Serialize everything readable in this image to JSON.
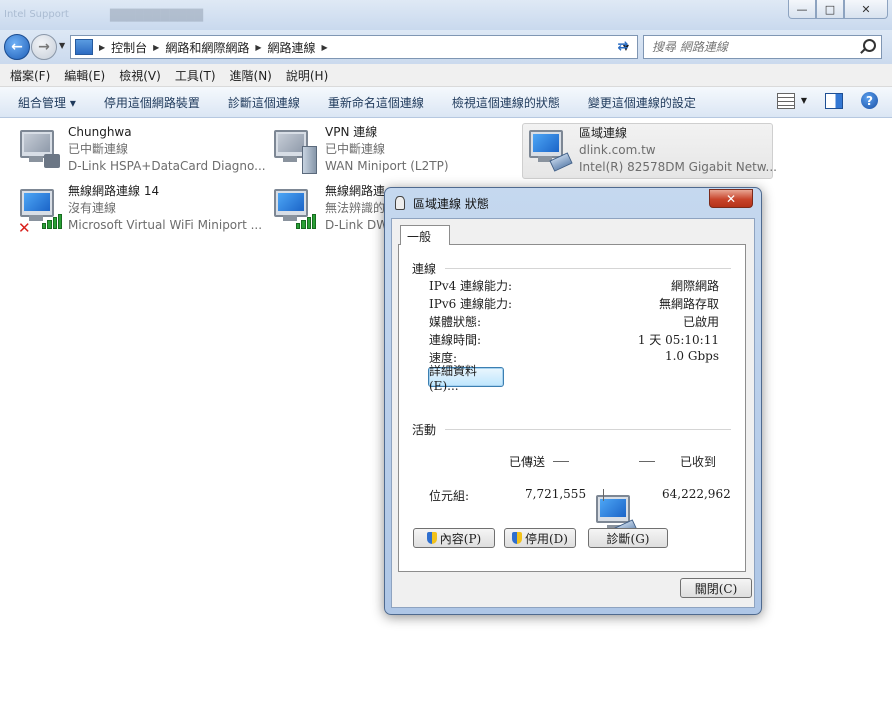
{
  "window": {
    "ghost_title": "███████████",
    "ghost_left": "Intel Support",
    "controls": [
      "—",
      "□",
      "✕"
    ]
  },
  "address": {
    "crumbs": [
      "控制台",
      "網路和網際網路",
      "網路連線"
    ],
    "search_placeholder": "搜尋 網路連線"
  },
  "menu": [
    "檔案(F)",
    "編輯(E)",
    "檢視(V)",
    "工具(T)",
    "進階(N)",
    "說明(H)"
  ],
  "commands": [
    "組合管理 ▾",
    "停用這個網路裝置",
    "診斷這個連線",
    "重新命名這個連線",
    "檢視這個連線的狀態",
    "變更這個連線的設定"
  ],
  "connections": [
    {
      "name": "Chunghwa",
      "status": "已中斷連線",
      "device": "D-Link HSPA+DataCard Diagno..."
    },
    {
      "name": "VPN 連線",
      "status": "已中斷連線",
      "device": "WAN Miniport (L2TP)"
    },
    {
      "name": "區域連線",
      "status": "dlink.com.tw",
      "device": "Intel(R) 82578DM Gigabit Netw..."
    },
    {
      "name": "無線網路連線 14",
      "status": "沒有連線",
      "device": "Microsoft Virtual WiFi Miniport ..."
    },
    {
      "name": "無線網路連",
      "status": "無法辨識的",
      "device": "D-Link DW"
    }
  ],
  "dialog": {
    "title": "區域連線 狀態",
    "close": "✕",
    "tab": "一般",
    "connection_section": "連線",
    "rows": [
      {
        "label": "IPv4 連線能力:",
        "value": "網際網路"
      },
      {
        "label": "IPv6 連線能力:",
        "value": "無網路存取"
      },
      {
        "label": "媒體狀態:",
        "value": "已啟用"
      },
      {
        "label": "連線時間:",
        "value": "1 天 05:10:11"
      },
      {
        "label": "速度:",
        "value": "1.0 Gbps"
      }
    ],
    "details_button": "詳細資料(E)...",
    "activity_section": "活動",
    "sent_label": "已傳送",
    "received_label": "已收到",
    "bytes_label": "位元組:",
    "bytes_sent": "7,721,555",
    "bytes_received": "64,222,962",
    "properties_button": "內容(P)",
    "disable_button": "停用(D)",
    "diagnose_button": "診斷(G)",
    "close_button": "關閉(C)"
  }
}
